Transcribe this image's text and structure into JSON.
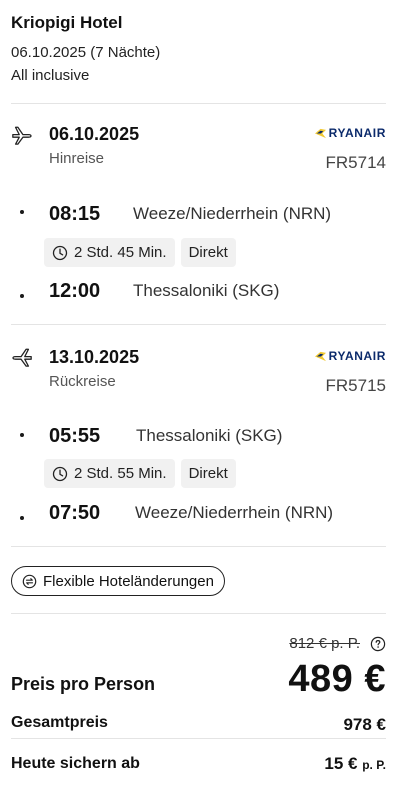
{
  "hotel": {
    "name": "Kriopigi Hotel",
    "dates": "06.10.2025 (7 Nächte)",
    "board": "All inclusive"
  },
  "outbound": {
    "date": "06.10.2025",
    "label": "Hinreise",
    "airline": "RYANAIR",
    "flight_number": "FR5714",
    "departure_time": "08:15",
    "departure_airport": "Weeze/Niederrhein (NRN)",
    "duration": "2 Std. 45 Min.",
    "stops": "Direkt",
    "arrival_time": "12:00",
    "arrival_airport": "Thessaloniki (SKG)"
  },
  "return": {
    "date": "13.10.2025",
    "label": "Rückreise",
    "airline": "RYANAIR",
    "flight_number": "FR5715",
    "departure_time": "05:55",
    "departure_airport": "Thessaloniki (SKG)",
    "duration": "2 Std. 55 Min.",
    "stops": "Direkt",
    "arrival_time": "07:50",
    "arrival_airport": "Weeze/Niederrhein (NRN)"
  },
  "flex_button": {
    "label": "Flexible Hoteländerungen",
    "icon": "flex-exchange-icon"
  },
  "pricing": {
    "old_price": "812 € p. P.",
    "per_person_label": "Preis pro Person",
    "per_person_value": "489 €",
    "total_label": "Gesamtpreis",
    "total_value": "978 €",
    "deposit_label": "Heute sichern ab",
    "deposit_value": "15 €",
    "deposit_suffix": "p. P."
  },
  "colors": {
    "airline_blue": "#0b2a6b",
    "airline_yellow": "#f1c933",
    "chip_bg": "#f1f1f1"
  }
}
